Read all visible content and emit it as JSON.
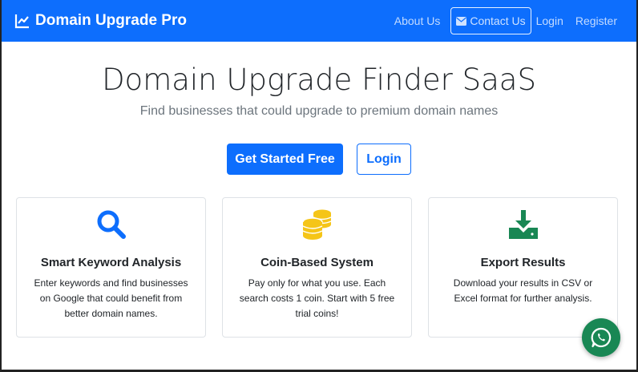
{
  "navbar": {
    "brand": "Domain Upgrade Pro",
    "links": {
      "about": "About Us",
      "contact": "Contact Us",
      "login": "Login",
      "register": "Register"
    }
  },
  "hero": {
    "title": "Domain Upgrade Finder SaaS",
    "subtitle": "Find businesses that could upgrade to premium domain names",
    "primary_button": "Get Started Free",
    "secondary_button": "Login"
  },
  "features": [
    {
      "icon": "search-icon",
      "title": "Smart Keyword Analysis",
      "description": "Enter keywords and find businesses on Google that could benefit from better domain names."
    },
    {
      "icon": "coins-icon",
      "title": "Coin-Based System",
      "description": "Pay only for what you use. Each search costs 1 coin. Start with 5 free trial coins!"
    },
    {
      "icon": "download-icon",
      "title": "Export Results",
      "description": "Download your results in CSV or Excel format for further analysis."
    }
  ],
  "colors": {
    "primary": "#0d6efd",
    "coin": "#f5c518",
    "success": "#198754"
  },
  "floating": {
    "icon": "whatsapp-icon"
  }
}
